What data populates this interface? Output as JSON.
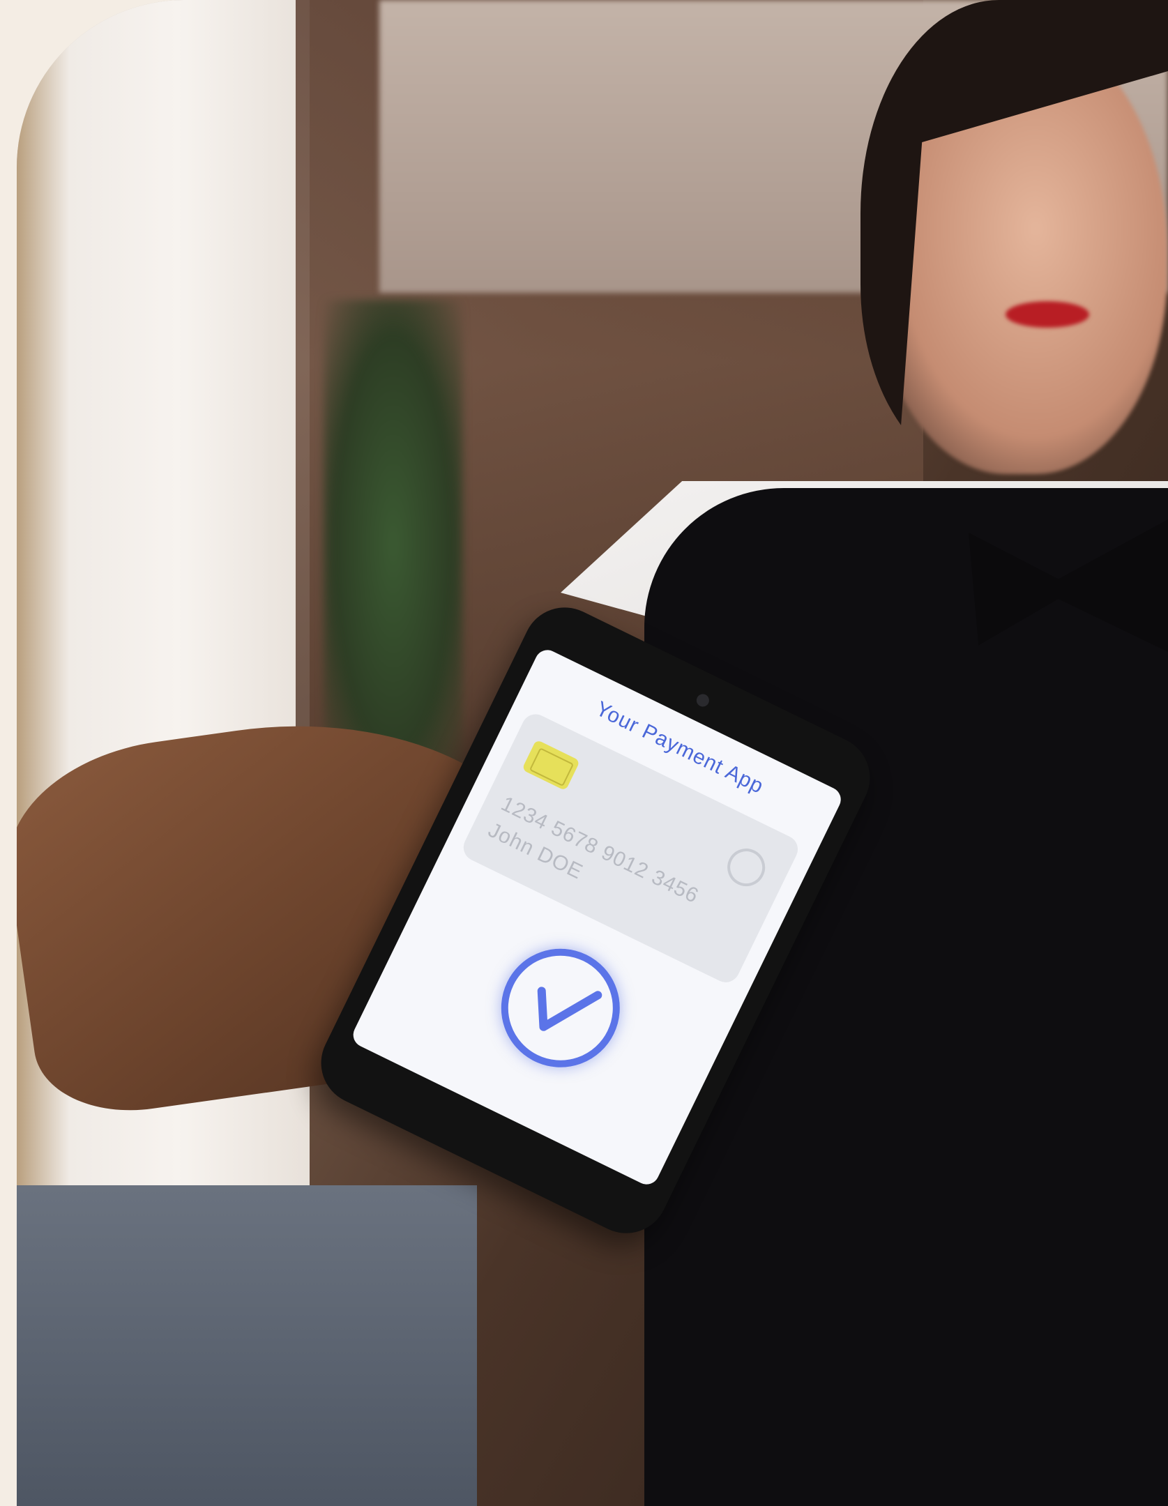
{
  "payment_app": {
    "title": "Your Payment App",
    "card_number": "1234 5678 9012 3456",
    "card_holder": "John DOE",
    "status_icon": "checkmark-icon"
  },
  "colors": {
    "background": "#f4ede4",
    "accent": "#5b74e8",
    "chip": "#e6e05a"
  }
}
